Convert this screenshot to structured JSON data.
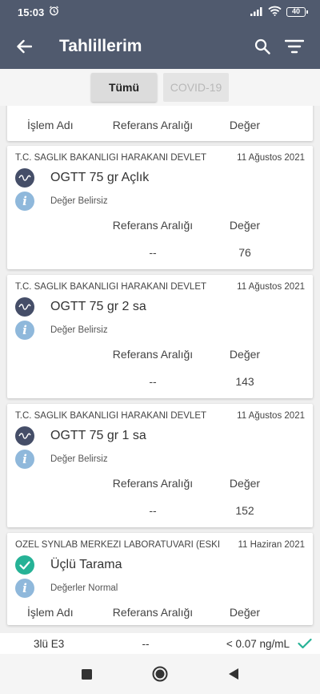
{
  "status": {
    "time": "15:03",
    "battery": "40"
  },
  "app": {
    "title": "Tahlillerim"
  },
  "tabs": [
    {
      "label": "Tümü",
      "active": true
    },
    {
      "label": "COVID-19",
      "active": false
    }
  ],
  "columns": {
    "name": "İşlem Adı",
    "ref": "Referans Aralığı",
    "value": "Değer"
  },
  "cards": [
    {
      "institution": "T.C. SAĞLIK BAKANLIĞI HARAKANİ DEVLET",
      "date": "11 Ağustos 2021",
      "test": "OGTT 75 gr Açlık",
      "status": "Değer Belirsiz",
      "ref": "--",
      "value": "76"
    },
    {
      "institution": "T.C. SAĞLIK BAKANLIĞI HARAKANİ DEVLET",
      "date": "11 Ağustos 2021",
      "test": "OGTT 75 gr 2 sa",
      "status": "Değer Belirsiz",
      "ref": "--",
      "value": "143"
    },
    {
      "institution": "T.C. SAĞLIK BAKANLIĞI HARAKANİ DEVLET",
      "date": "11 Ağustos 2021",
      "test": "OGTT 75 gr 1 sa",
      "status": "Değer Belirsiz",
      "ref": "--",
      "value": "152"
    },
    {
      "institution": "ÖZEL SYNLAB MERKEZİ LABORATUVARI (ESKİ",
      "date": "11 Haziran 2021",
      "test": "Üçlü Tarama",
      "status": "Değerler Normal"
    }
  ],
  "result_row": {
    "name": "3lü  E3",
    "ref": "--",
    "value": "< 0.07 ng/mL"
  }
}
